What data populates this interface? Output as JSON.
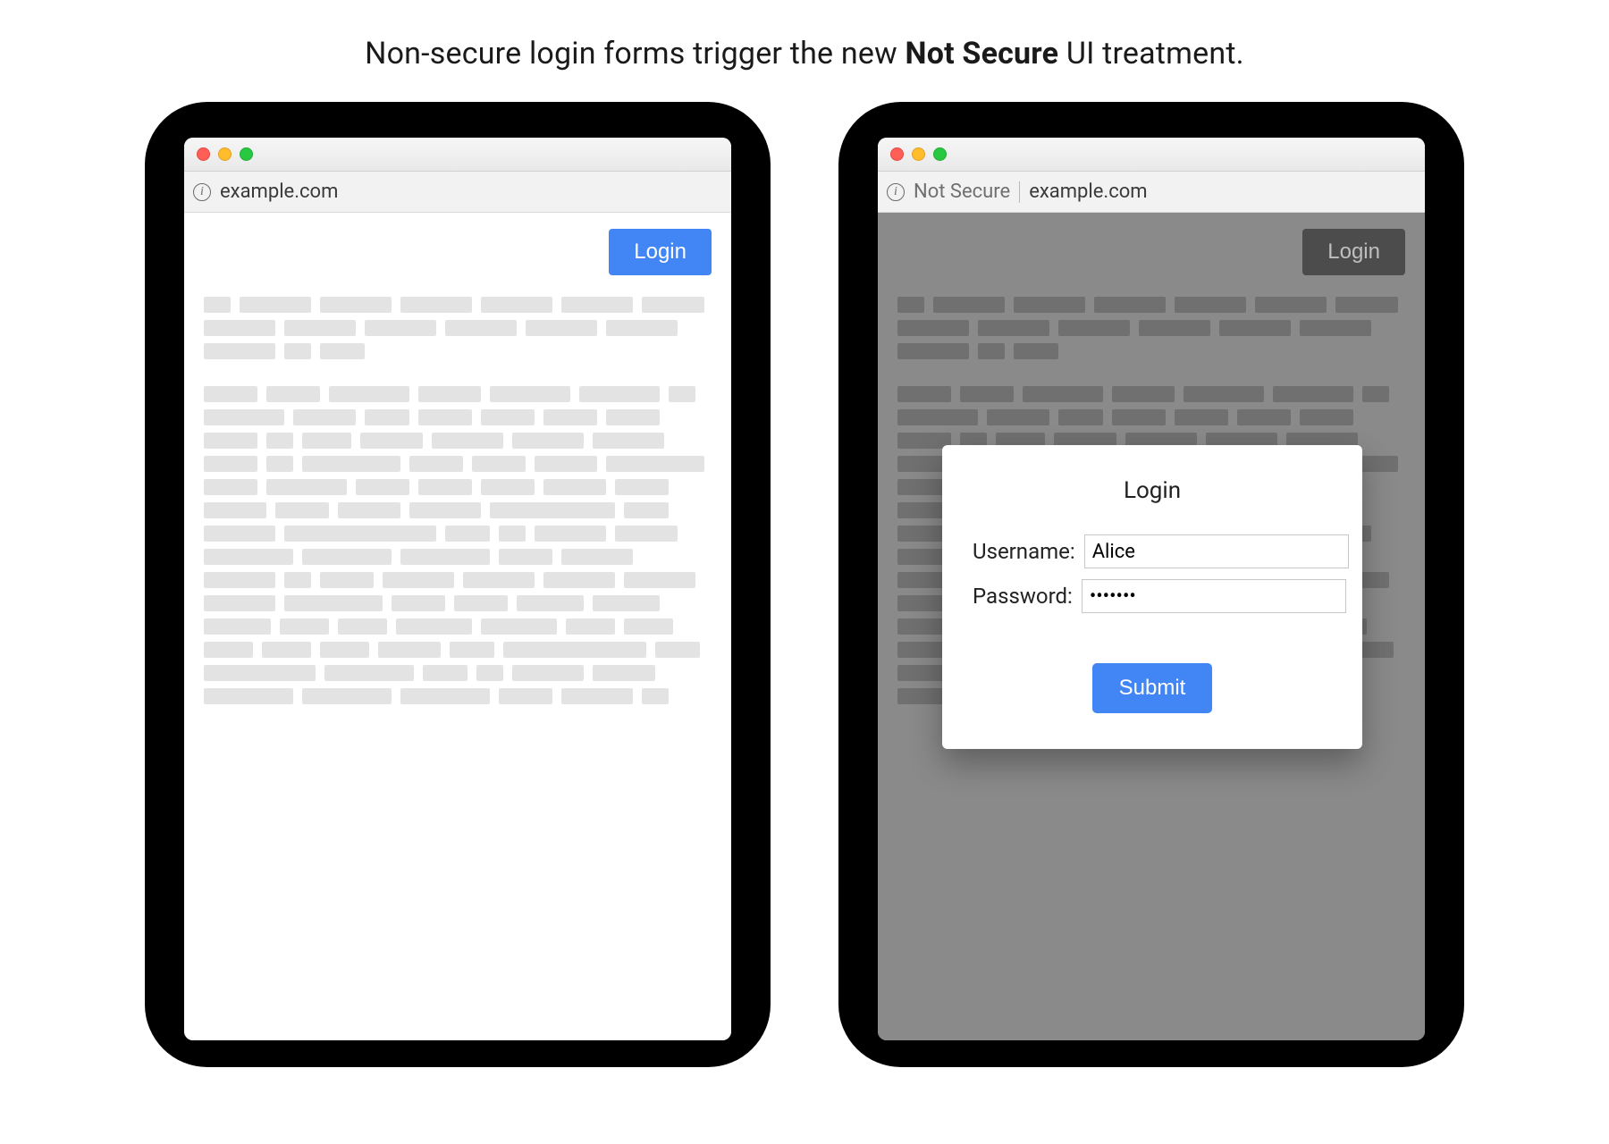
{
  "caption_prefix": "Non-secure login forms trigger the new ",
  "caption_bold": "Not Secure",
  "caption_suffix": " UI treatment.",
  "left_browser": {
    "address_url": "example.com",
    "login_button": "Login"
  },
  "right_browser": {
    "security_label": "Not Secure",
    "address_url": "example.com",
    "login_button": "Login",
    "modal": {
      "title": "Login",
      "username_label": "Username:",
      "username_value": "Alice",
      "password_label": "Password:",
      "password_value": "•••••••",
      "submit_label": "Submit"
    }
  },
  "placeholder_widths_block1": [
    30,
    80,
    80,
    80,
    80,
    80,
    70,
    80,
    80,
    80,
    80,
    80,
    80,
    80,
    30,
    50
  ],
  "placeholder_widths_block2": [
    60,
    60,
    90,
    70,
    90,
    90,
    30,
    90,
    70,
    50,
    60,
    60,
    60,
    60,
    60,
    30,
    55,
    70,
    80,
    80,
    80,
    60,
    30,
    110,
    60,
    60,
    70,
    110,
    60,
    90,
    60,
    60,
    60,
    70,
    60,
    70,
    60,
    70,
    80,
    140,
    50,
    80,
    170,
    50,
    30,
    80,
    70,
    100,
    100,
    100,
    60,
    80,
    80,
    30,
    60,
    80,
    80,
    80,
    80,
    80,
    110,
    60,
    60,
    75,
    75,
    75,
    55,
    55,
    85,
    85,
    55,
    55,
    55,
    55,
    55,
    70,
    50,
    160,
    50,
    125,
    100,
    50,
    30,
    80,
    70,
    100,
    100,
    100,
    60,
    80,
    30
  ]
}
